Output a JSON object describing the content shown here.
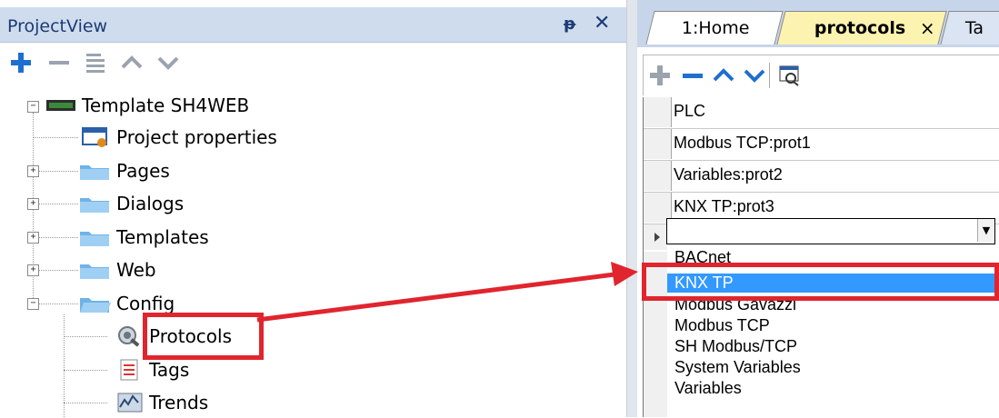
{
  "project_view": {
    "title": "ProjectView",
    "pin_glyph": "ᵽ",
    "close_glyph": "✕",
    "toolbar": [
      "add-icon",
      "remove-icon",
      "properties-icon",
      "move-up-icon",
      "move-down-icon"
    ],
    "tree": {
      "root": "Template SH4WEB",
      "items": [
        "Project properties",
        "Pages",
        "Dialogs",
        "Templates",
        "Web",
        "Config"
      ],
      "config_children": [
        "Protocols",
        "Tags",
        "Trends"
      ]
    }
  },
  "tabs": {
    "home": "1:Home",
    "protocols": "protocols",
    "close": "×",
    "next": "Ta"
  },
  "grid": {
    "header": "PLC",
    "rows": [
      "Modbus TCP:prot1",
      "Variables:prot2",
      "KNX TP:prot3"
    ],
    "current_value": "",
    "dropdown_arrow": "▼"
  },
  "dropdown_options": [
    {
      "label": "BACnet",
      "selected": false
    },
    {
      "label": "KNX TP",
      "selected": true
    },
    {
      "label": "Modbus Gavazzi",
      "selected": false
    },
    {
      "label": "Modbus TCP",
      "selected": false
    },
    {
      "label": "SH Modbus/TCP",
      "selected": false
    },
    {
      "label": "System Variables",
      "selected": false
    },
    {
      "label": "Variables",
      "selected": false
    }
  ],
  "colors": {
    "accent_blue": "#1f6fd0",
    "highlight_red": "#e0252e",
    "selection_blue": "#3399ff"
  }
}
